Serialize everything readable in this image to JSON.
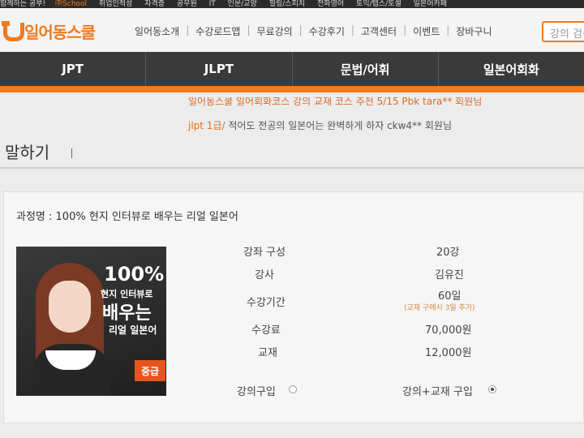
{
  "top_strip": {
    "items": [
      "함께하는 공부!",
      "취업인적성",
      "자격증",
      "공무원",
      "IT",
      "인문/교양",
      "힐링/스피치",
      "전화영어",
      "토익/텝스/토셀",
      "일본어카페"
    ],
    "highlight": "㈜School"
  },
  "header": {
    "logo_text": "일어동스쿨",
    "nav": [
      "일어동소개",
      "수강로드맵",
      "무료강의",
      "수강후기",
      "고객센터",
      "이벤트",
      "장바구니"
    ],
    "search_placeholder": "강의 검색"
  },
  "main_nav": [
    "JPT",
    "JLPT",
    "문법/어휘",
    "일본어회화"
  ],
  "ticker": {
    "line1": "일어동스쿨 일어회화코스 강의 교재 코스 추천 5/15 Pbk tara** 회원님",
    "line2_prefix": "jlpt 1급/",
    "line2_text": " 적어도 전공의 일본어는 완벽하게 하자 ",
    "line2_user": "ckw4**",
    "line2_suffix": " 회원님"
  },
  "section_title": "말하기",
  "course": {
    "name_label": "과정명 : 100% 현지 인터뷰로 배우는 리얼 일본어",
    "thumb": {
      "line1": "100%",
      "line2": "현지 인터뷰로",
      "line3": "배우는",
      "line4": "리얼 일본어",
      "level": "중급"
    },
    "rows": [
      {
        "label": "강좌 구성",
        "value": "20강"
      },
      {
        "label": "강사",
        "value": "김유진"
      },
      {
        "label": "수강기간",
        "value": "60일"
      },
      {
        "label": "수강료",
        "value": "70,000원"
      },
      {
        "label": "교재",
        "value": "12,000원"
      }
    ],
    "period_note": "(교재 구매시 3일 추가)",
    "purchase_options": [
      {
        "label": "강의구입",
        "checked": false
      },
      {
        "label": "강의+교재 구입",
        "checked": true
      }
    ]
  },
  "colors": {
    "accent": "#f07a1e",
    "nav_bg": "#3a3a3a",
    "level_badge": "#e8541e"
  }
}
